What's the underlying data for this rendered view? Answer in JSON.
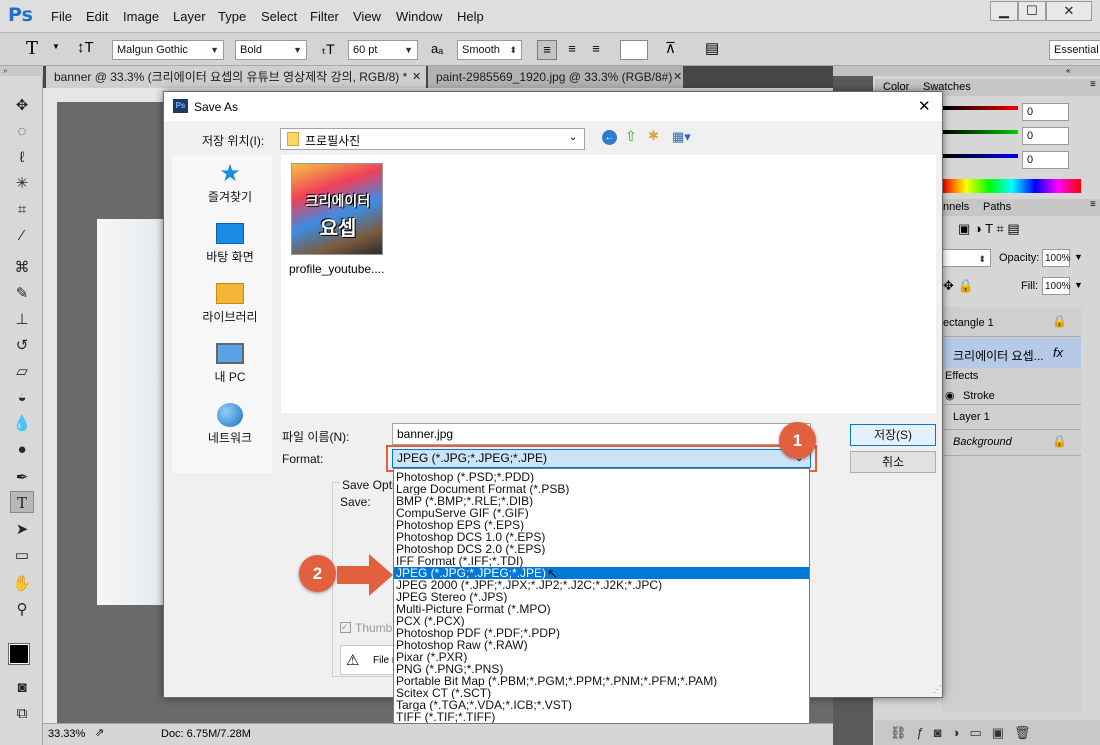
{
  "app": {
    "logo": "Ps"
  },
  "menu": [
    "File",
    "Edit",
    "Image",
    "Layer",
    "Type",
    "Select",
    "Filter",
    "View",
    "Window",
    "Help"
  ],
  "options": {
    "font_family": "Malgun Gothic",
    "font_style": "Bold",
    "font_size": "60 pt",
    "aa_label": "aₐ",
    "antialias": "Smooth",
    "workspace": "Essential"
  },
  "tabs": [
    {
      "label": "banner @ 33.3% (크리에이터 요셉의 유튜브 영상제작 강의, RGB/8) *"
    },
    {
      "label": "paint-2985569_1920.jpg @ 33.3% (RGB/8#) *"
    }
  ],
  "status": {
    "zoom": "33.33%",
    "doc": "Doc: 6.75M/7.28M"
  },
  "panels": {
    "color_tab": "Color",
    "swatches_tab": "Swatches",
    "rgb_values": [
      "0",
      "0",
      "0"
    ],
    "channels_tab": "nnels",
    "paths_tab": "Paths",
    "opacity_label": "Opacity:",
    "opacity_value": "100%",
    "fill_label": "Fill:",
    "fill_value": "100%",
    "layers": [
      {
        "name": "ectangle 1"
      },
      {
        "name": "크리에이터 요셉..."
      },
      {
        "name": "Effects"
      },
      {
        "name": "Stroke"
      },
      {
        "name": "Layer 1"
      },
      {
        "name": "Background"
      }
    ],
    "fx_label": "fx"
  },
  "dialog": {
    "title": "Save As",
    "location_label": "저장 위치(I):",
    "location_value": "프로필사진",
    "places": [
      "즐겨찾기",
      "바탕 화면",
      "라이브러리",
      "내 PC",
      "네트워크"
    ],
    "file_item": "profile_youtube....",
    "thumb_text_top": "크리에이터",
    "thumb_text_bottom": "요셉",
    "filename_label": "파일 이름(N):",
    "filename_value": "banner.jpg",
    "format_label": "Format:",
    "format_value": "JPEG (*.JPG;*.JPEG;*.JPE)",
    "save_button": "저장(S)",
    "cancel_button": "취소",
    "save_options_label": "Save Opti",
    "save_label": "Save:",
    "thumbnail_label": "Thumb",
    "file_note": "File n",
    "format_options": [
      "Photoshop (*.PSD;*.PDD)",
      "Large Document Format (*.PSB)",
      "BMP (*.BMP;*.RLE;*.DIB)",
      "CompuServe GIF (*.GIF)",
      "Photoshop EPS (*.EPS)",
      "Photoshop DCS 1.0 (*.EPS)",
      "Photoshop DCS 2.0 (*.EPS)",
      "IFF Format (*.IFF;*.TDI)",
      "JPEG (*.JPG;*.JPEG;*.JPE)",
      "JPEG 2000 (*.JPF;*.JPX;*.JP2;*.J2C;*.J2K;*.JPC)",
      "JPEG Stereo (*.JPS)",
      "Multi-Picture Format (*.MPO)",
      "PCX (*.PCX)",
      "Photoshop PDF (*.PDF;*.PDP)",
      "Photoshop Raw (*.RAW)",
      "Pixar (*.PXR)",
      "PNG (*.PNG;*.PNS)",
      "Portable Bit Map (*.PBM;*.PGM;*.PPM;*.PNM;*.PFM;*.PAM)",
      "Scitex CT (*.SCT)",
      "Targa (*.TGA;*.VDA;*.ICB;*.VST)",
      "TIFF (*.TIF;*.TIFF)"
    ],
    "selected_index": 8
  },
  "annotations": [
    "1",
    "2"
  ],
  "colors": {
    "accent": "#e2603d",
    "selection": "#0078d7",
    "ps_blue": "#1f71c7"
  }
}
